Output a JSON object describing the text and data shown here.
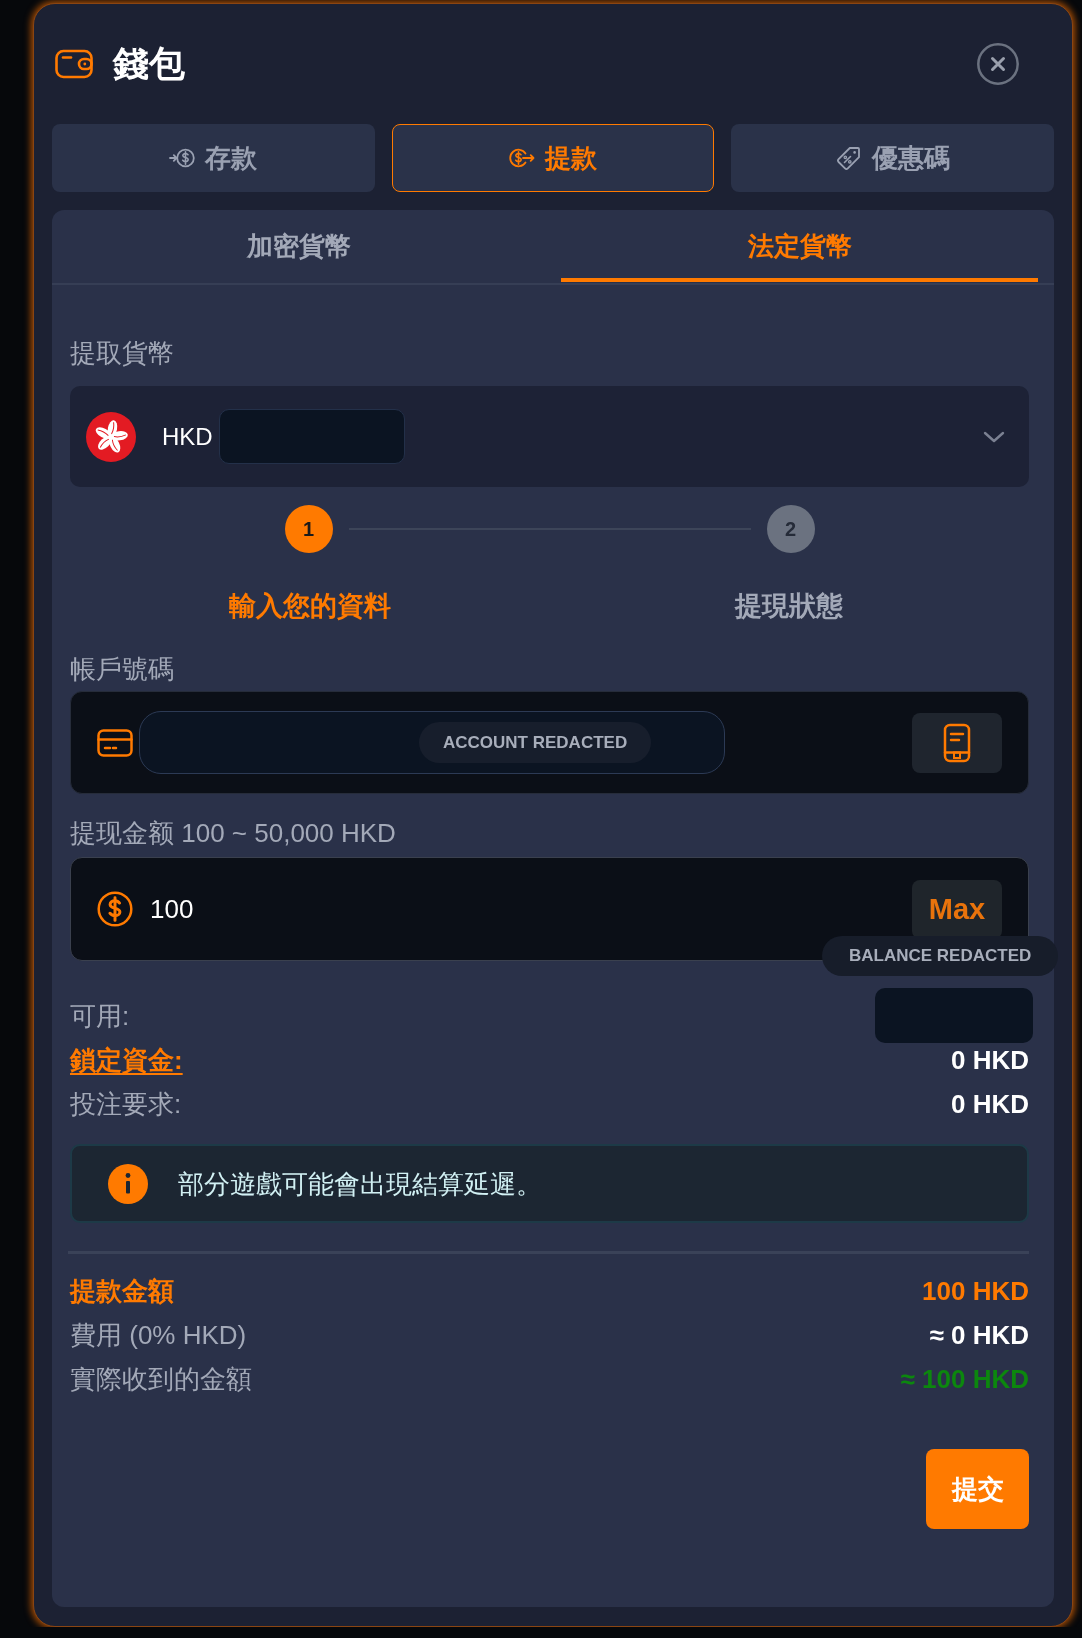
{
  "dialog": {
    "title": "錢包"
  },
  "tabs": [
    {
      "label": "存款",
      "kind": "deposit",
      "selected": false
    },
    {
      "label": "提款",
      "kind": "withdraw",
      "selected": true
    },
    {
      "label": "優惠碼",
      "kind": "promo",
      "selected": false
    }
  ],
  "sub_tabs": [
    {
      "label": "加密貨幣",
      "selected": false
    },
    {
      "label": "法定貨幣",
      "selected": true
    }
  ],
  "currency": {
    "label": "提取貨幣",
    "code": "HKD",
    "redacted": true
  },
  "steps": [
    {
      "number": "1",
      "label": "輸入您的資料",
      "active": true
    },
    {
      "number": "2",
      "label": "提現狀態",
      "active": false
    }
  ],
  "account": {
    "label": "帳戶號碼",
    "redaction_label": "ACCOUNT REDACTED"
  },
  "amount": {
    "label": "提现金额 100 ~ 50,000 HKD",
    "value": "100",
    "max_button": "Max",
    "redaction_label": "BALANCE REDACTED"
  },
  "balances": [
    {
      "label": "可用:",
      "kind": "text",
      "redacted": true
    },
    {
      "label": "鎖定資金:",
      "kind": "link",
      "redacted": false,
      "value": "0 HKD"
    },
    {
      "label": "投注要求:",
      "kind": "text",
      "redacted": false,
      "value": "0 HKD"
    }
  ],
  "notice": {
    "text": "部分遊戲可能會出現結算延遲。"
  },
  "summary": [
    {
      "label": "提款金額",
      "value": "100 HKD",
      "kind": "highlight"
    },
    {
      "label": "費用 (0% HKD)",
      "value": "≈ 0 HKD",
      "kind": "plain"
    },
    {
      "label": "實際收到的金額",
      "value": "≈ 100 HKD",
      "kind": "positive"
    }
  ],
  "submit_button": "提交"
}
